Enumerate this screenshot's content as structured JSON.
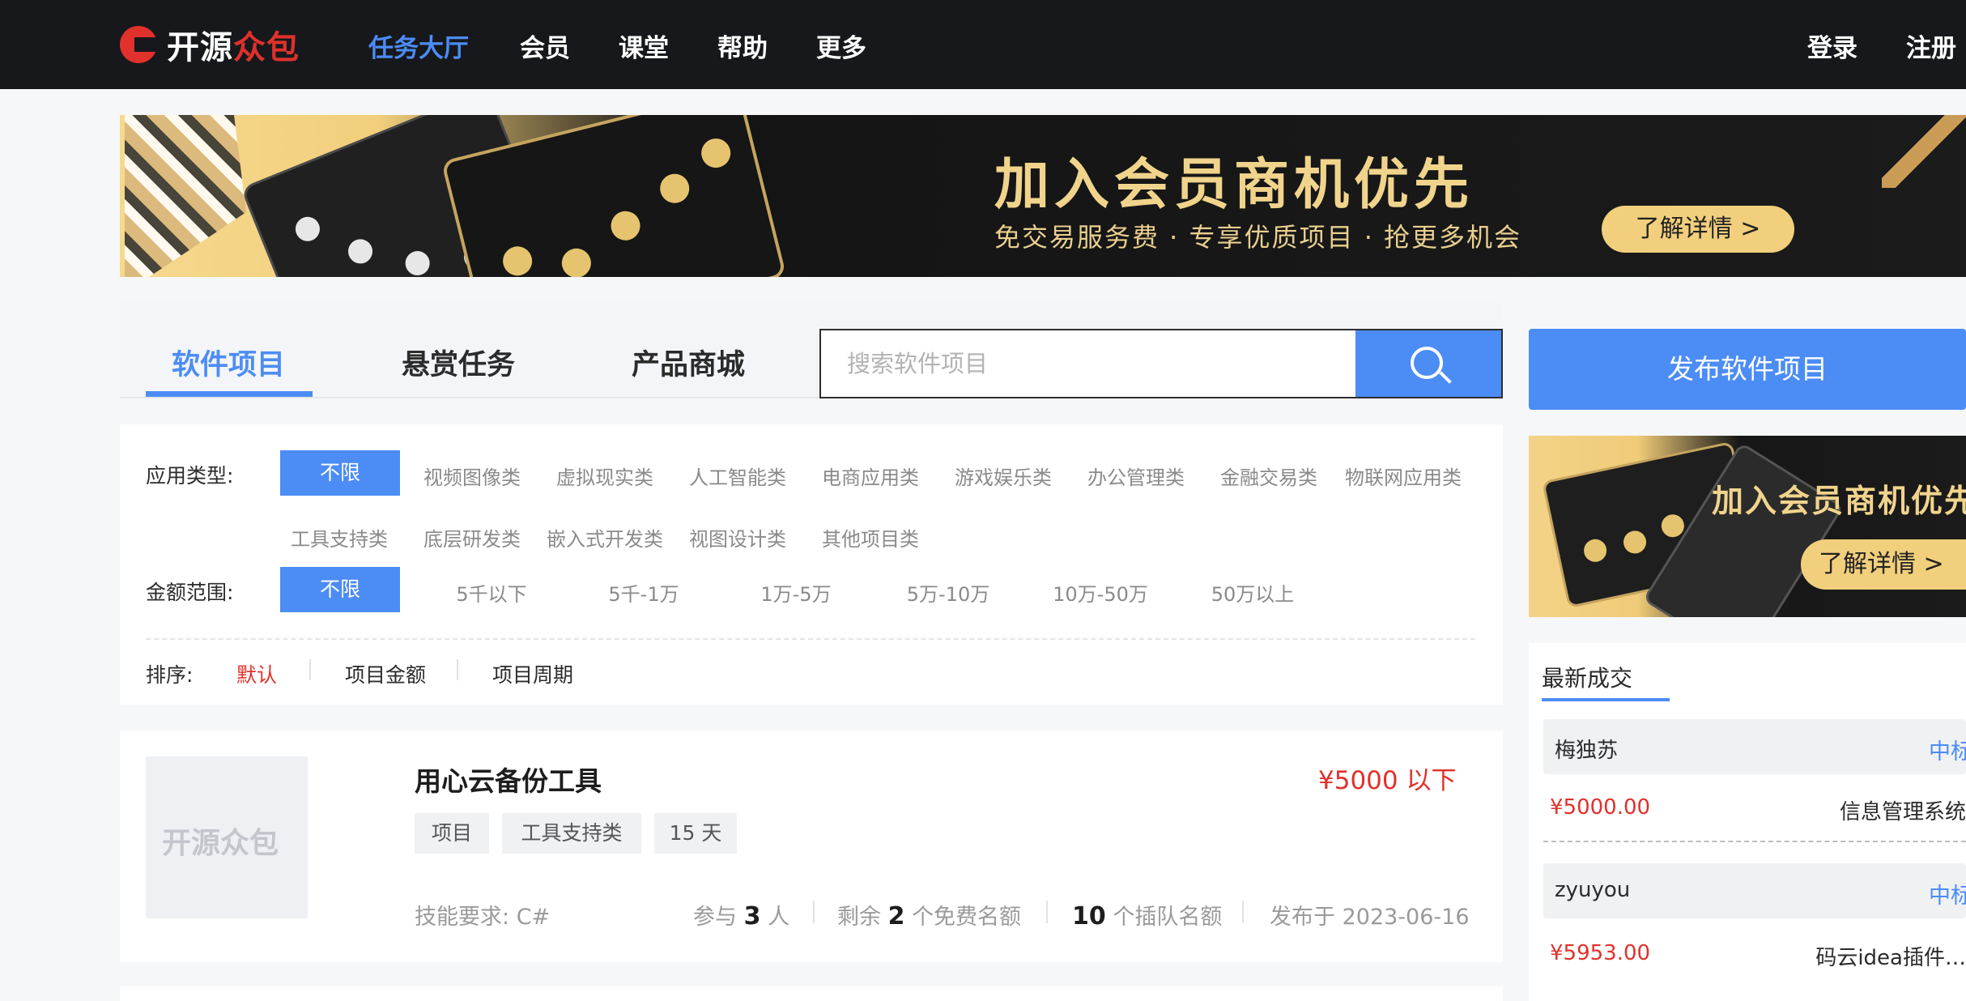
{
  "nav": {
    "logo_text_main": "开源",
    "logo_text_accent": "众包",
    "items": [
      "任务大厅",
      "会员",
      "课堂",
      "帮助",
      "更多"
    ],
    "login": "登录",
    "register": "注册"
  },
  "banner": {
    "title": "加入会员商机优先",
    "subtitle": "免交易服务费 · 专享优质项目 · 抢更多机会",
    "button": "了解详情 >"
  },
  "tabs": [
    "软件项目",
    "悬赏任务",
    "产品商城"
  ],
  "search": {
    "placeholder": "搜索软件项目"
  },
  "filters": {
    "app_type_label": "应用类型:",
    "app_types_row1": [
      "不限",
      "视频图像类",
      "虚拟现实类",
      "人工智能类",
      "电商应用类",
      "游戏娱乐类",
      "办公管理类",
      "金融交易类",
      "物联网应用类"
    ],
    "app_types_row2": [
      "工具支持类",
      "底层研发类",
      "嵌入式开发类",
      "视图设计类",
      "其他项目类"
    ],
    "amount_label": "金额范围:",
    "amounts": [
      "不限",
      "5千以下",
      "5千-1万",
      "1万-5万",
      "5万-10万",
      "10万-50万",
      "50万以上"
    ],
    "sort_label": "排序:",
    "sorts": [
      "默认",
      "项目金额",
      "项目周期"
    ]
  },
  "project": {
    "thumb_logo": "开源众包",
    "title": "用心云备份工具",
    "price": "¥5000 以下",
    "tags": [
      "项目",
      "工具支持类",
      "15 天"
    ],
    "skills_label": "技能要求:",
    "skills": "C#",
    "participants_prefix": "参与",
    "participants": "3",
    "participants_suffix": "人",
    "free_prefix": "剩余",
    "free_slots": "2",
    "free_suffix": "个免费名额",
    "queue_slots": "10",
    "queue_suffix": "个插队名额",
    "published_prefix": "发布于",
    "published_date": "2023-06-16"
  },
  "sidebar": {
    "publish_button": "发布软件项目",
    "banner_title": "加入会员商机优先",
    "banner_button": "了解详情 >",
    "deals_title": "最新成交",
    "deals": [
      {
        "name": "梅独苏",
        "status": "中标",
        "amount": "¥5000.00",
        "project": "信息管理系统"
      },
      {
        "name": "zyuyou",
        "status": "中标",
        "amount": "¥5953.00",
        "project": "码云idea插件…"
      }
    ]
  },
  "colors": {
    "accent": "#4c8cf5",
    "brand_red": "#e0312c",
    "nav_bg": "#17181b",
    "price_red": "#e1312b",
    "gold": "#f1cf7c"
  }
}
